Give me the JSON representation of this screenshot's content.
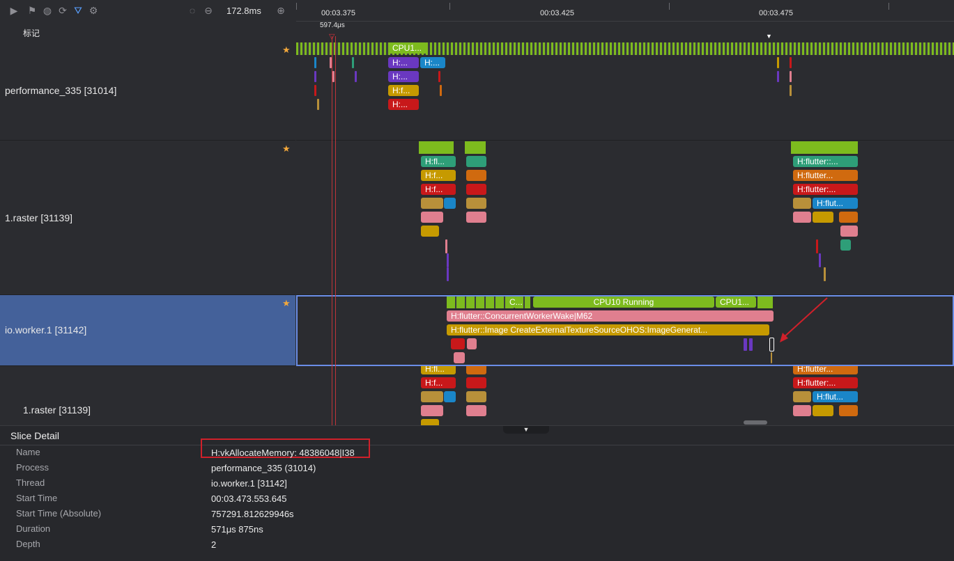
{
  "toolbar": {
    "icons": [
      "play-icon",
      "flag-icon",
      "globe-icon",
      "refresh-icon",
      "filter-icon",
      "gear-icon"
    ],
    "zoom_value": "172.8ms"
  },
  "ruler": {
    "ticks": [
      "00:03.375",
      "00:03.425",
      "00:03.475"
    ]
  },
  "marker": {
    "label": "标记",
    "flag_value": "597.4μs"
  },
  "lanes": [
    {
      "label": "performance_335 [31014]"
    },
    {
      "label": "1.raster [31139]"
    },
    {
      "label": "io.worker.1 [31142]"
    },
    {
      "label": "1.raster [31139]"
    }
  ],
  "slices": {
    "perf_cpu": "CPU1...",
    "perf_h1": "H:...",
    "perf_h2": "H:...",
    "perf_h3": "H:...",
    "perf_h4": "H:f...",
    "perf_h5": "H:...",
    "raster_a1": "H:fl...",
    "raster_a2": "H:f...",
    "raster_a3": "H:f...",
    "raster_b1": "H:flutter::...",
    "raster_b2": "H:flutter...",
    "raster_b3": "H:flutter:...",
    "raster_b4": "H:flut...",
    "io_cpu_a": "C...",
    "io_cpu_main": "CPU10 Running",
    "io_cpu_b": "CPU1...",
    "io_wake": "H:flutter::ConcurrentWorkerWake|M62",
    "io_image": "H:flutter::Image CreateExternalTextureSourceOHOS:ImageGenerat...",
    "raster2_a1": "H:fl...",
    "raster2_a2": "H:f...",
    "raster2_b1": "H:flutter...",
    "raster2_b2": "H:flutter:...",
    "raster2_b3": "H:flut..."
  },
  "detail": {
    "title": "Slice Detail",
    "rows": [
      {
        "key": "Name",
        "value": "H:vkAllocateMemory: 48386048|I38"
      },
      {
        "key": "Process",
        "value": "performance_335 (31014)"
      },
      {
        "key": "Thread",
        "value": "io.worker.1 [31142]"
      },
      {
        "key": "Start Time",
        "value": "00:03.473.553.645"
      },
      {
        "key": "Start Time (Absolute)",
        "value": "757291.812629946s"
      },
      {
        "key": "Duration",
        "value": "571μs 875ns"
      },
      {
        "key": "Depth",
        "value": "2"
      }
    ]
  },
  "colors": {
    "green": "#7dbb1e",
    "teal": "#2e9e78",
    "orange": "#d06a0f",
    "red": "#c8181a",
    "blue": "#1a86c8",
    "purple": "#6a38c0",
    "gold": "#c69a00",
    "pink": "#e07f8f",
    "tan": "#b8903a",
    "selection": "#44619a",
    "highlight": "#d0202a"
  }
}
